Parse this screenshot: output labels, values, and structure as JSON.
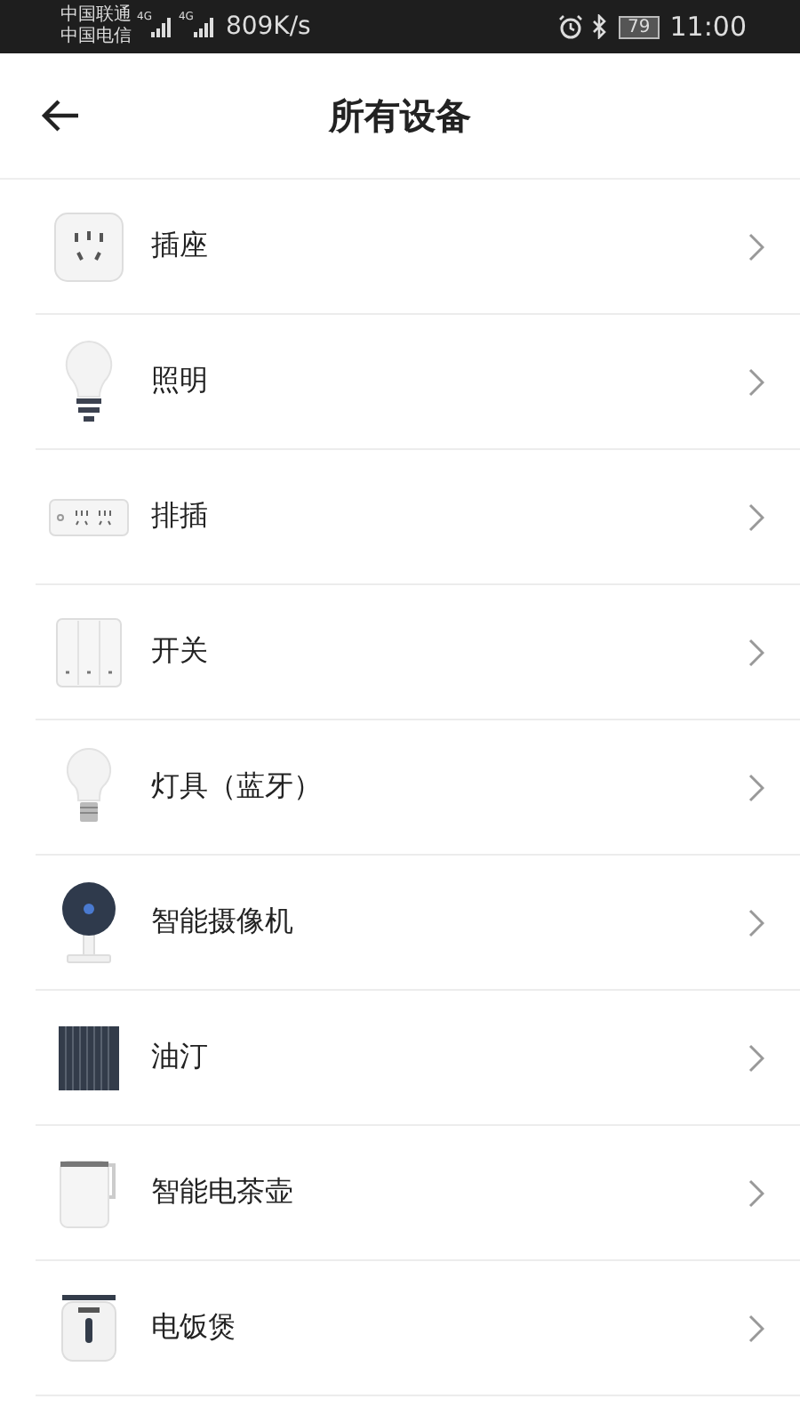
{
  "status_bar": {
    "carriers": [
      "中国联通",
      "中国电信"
    ],
    "network_labels": [
      "4G",
      "4G"
    ],
    "speed": "809K/s",
    "battery": "79",
    "time": "11:00"
  },
  "header": {
    "title": "所有设备"
  },
  "devices": [
    {
      "name": "插座",
      "kind": "socket"
    },
    {
      "name": "照明",
      "kind": "bulb"
    },
    {
      "name": "排插",
      "kind": "strip"
    },
    {
      "name": "开关",
      "kind": "switch"
    },
    {
      "name": "灯具（蓝牙）",
      "kind": "lamp"
    },
    {
      "name": "智能摄像机",
      "kind": "camera"
    },
    {
      "name": "油汀",
      "kind": "heater"
    },
    {
      "name": "智能电茶壶",
      "kind": "kettle"
    },
    {
      "name": "电饭煲",
      "kind": "cooker"
    }
  ]
}
